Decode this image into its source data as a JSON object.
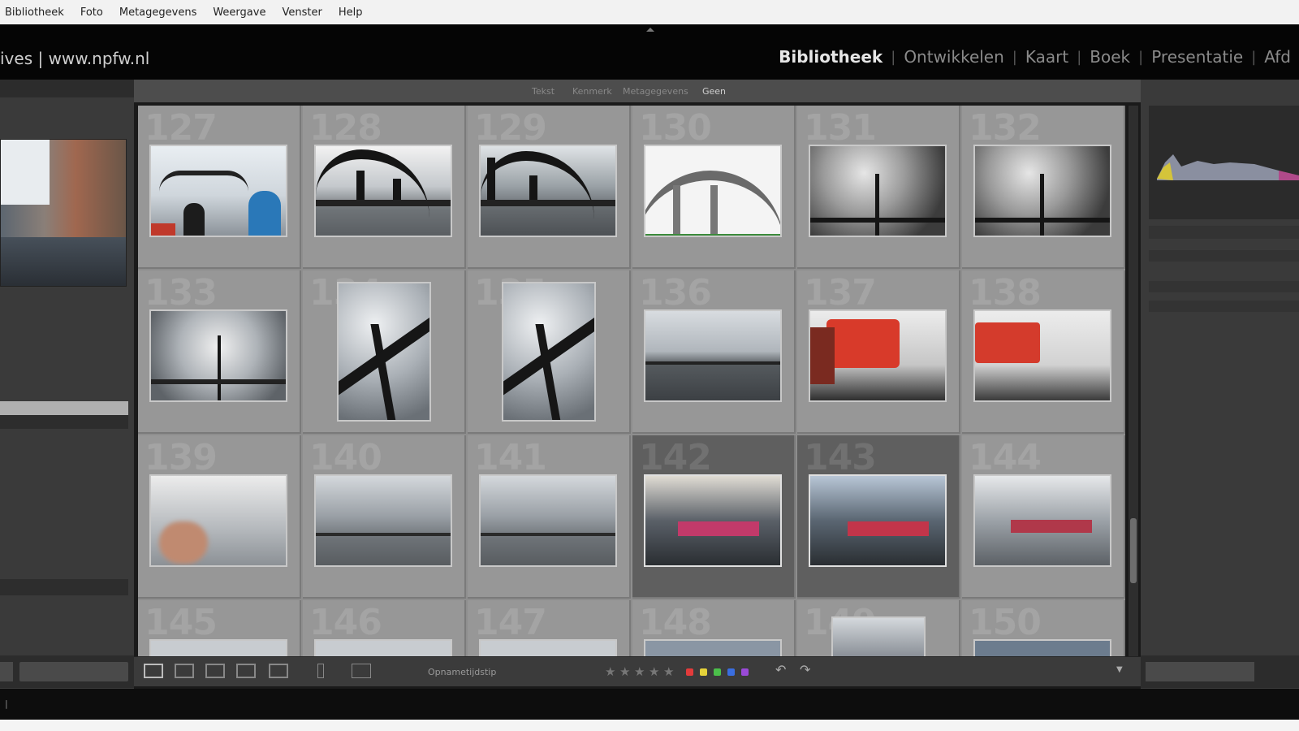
{
  "menubar": {
    "items": [
      "Bibliotheek",
      "Foto",
      "Metagegevens",
      "Weergave",
      "Venster",
      "Help"
    ]
  },
  "identity": {
    "text": "ives | www.npfw.nl"
  },
  "modules": {
    "items": [
      "Bibliotheek",
      "Ontwikkelen",
      "Kaart",
      "Boek",
      "Presentatie",
      "Afd"
    ],
    "active": "Bibliotheek"
  },
  "filterbar": {
    "tabs": [
      "Tekst",
      "Kenmerk",
      "Metagegevens",
      "Geen"
    ],
    "active": "Geen"
  },
  "grid": {
    "cells": [
      {
        "num": "127"
      },
      {
        "num": "128"
      },
      {
        "num": "129"
      },
      {
        "num": "130"
      },
      {
        "num": "131"
      },
      {
        "num": "132"
      },
      {
        "num": "133"
      },
      {
        "num": "134"
      },
      {
        "num": "135"
      },
      {
        "num": "136"
      },
      {
        "num": "137"
      },
      {
        "num": "138"
      },
      {
        "num": "139"
      },
      {
        "num": "140"
      },
      {
        "num": "141"
      },
      {
        "num": "142"
      },
      {
        "num": "143"
      },
      {
        "num": "144"
      },
      {
        "num": "145"
      },
      {
        "num": "146"
      },
      {
        "num": "147"
      },
      {
        "num": "148"
      },
      {
        "num": "149"
      },
      {
        "num": "150"
      }
    ],
    "selected": [
      "142",
      "143"
    ]
  },
  "toolbar": {
    "sort_label": "Opnametijdstip"
  },
  "colors": {
    "accent_red": "#e33b3b",
    "accent_yellow": "#e5d23a",
    "accent_green": "#4bbf4a",
    "accent_blue": "#3a6ee0",
    "accent_purple": "#9a4ad8",
    "panel": "#3a3a3a",
    "grid": "#8e8e8e"
  }
}
